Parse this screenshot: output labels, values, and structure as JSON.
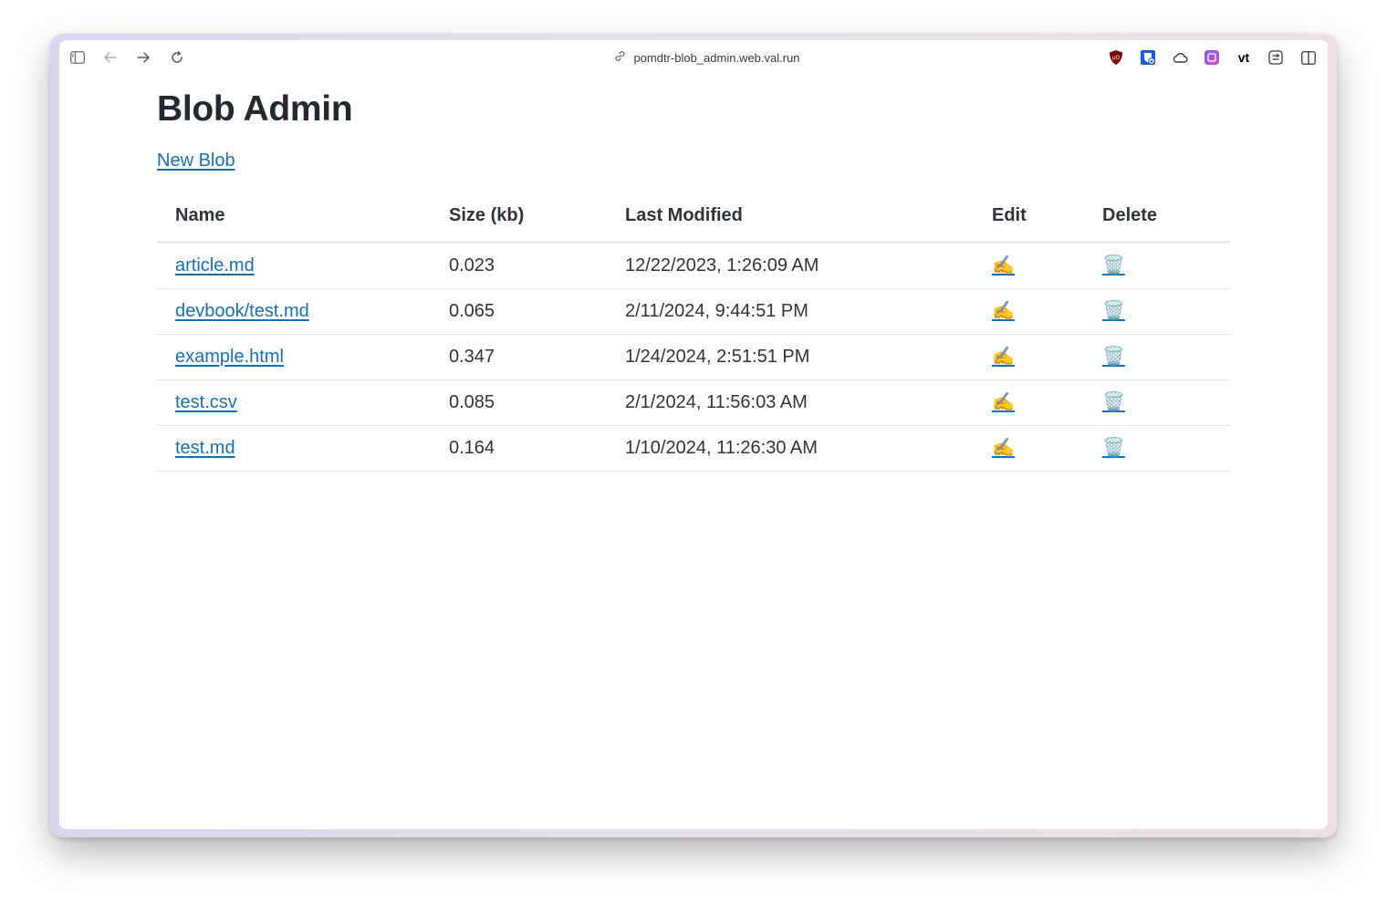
{
  "browser": {
    "url": "pomdtr-blob_admin.web.val.run",
    "icons": {
      "sidebar": "sidebar-toggle-icon",
      "back": "back-arrow-icon",
      "forward": "forward-arrow-icon",
      "reload": "reload-icon",
      "link": "link-icon"
    },
    "extensions": [
      {
        "name": "ublock-icon",
        "color": "#800000"
      },
      {
        "name": "bitwarden-icon",
        "color": "#175ddc"
      },
      {
        "name": "cloud-icon",
        "color": "#3a3a3c"
      },
      {
        "name": "extension-purple-icon",
        "color": "#c04de0"
      },
      {
        "name": "vt-icon",
        "label": "vt",
        "color": "#000000"
      },
      {
        "name": "extension-box-icon",
        "color": "#3a3a3c"
      },
      {
        "name": "split-view-icon",
        "color": "#3a3a3c"
      }
    ]
  },
  "page": {
    "title": "Blob Admin",
    "new_blob_label": "New Blob",
    "table": {
      "headers": [
        "Name",
        "Size (kb)",
        "Last Modified",
        "Edit",
        "Delete"
      ],
      "rows": [
        {
          "name": "article.md",
          "size": "0.023",
          "modified": "12/22/2023, 1:26:09 AM",
          "edit": "✍️",
          "delete": "🗑️"
        },
        {
          "name": "devbook/test.md",
          "size": "0.065",
          "modified": "2/11/2024, 9:44:51 PM",
          "edit": "✍️",
          "delete": "🗑️"
        },
        {
          "name": "example.html",
          "size": "0.347",
          "modified": "1/24/2024, 2:51:51 PM",
          "edit": "✍️",
          "delete": "🗑️"
        },
        {
          "name": "test.csv",
          "size": "0.085",
          "modified": "2/1/2024, 11:56:03 AM",
          "edit": "✍️",
          "delete": "🗑️"
        },
        {
          "name": "test.md",
          "size": "0.164",
          "modified": "1/10/2024, 11:26:30 AM",
          "edit": "✍️",
          "delete": "🗑️"
        }
      ]
    }
  },
  "colors": {
    "link": "#1a6fb0",
    "text": "#303438",
    "heading": "#24292f",
    "divider": "#e6e8ea"
  }
}
